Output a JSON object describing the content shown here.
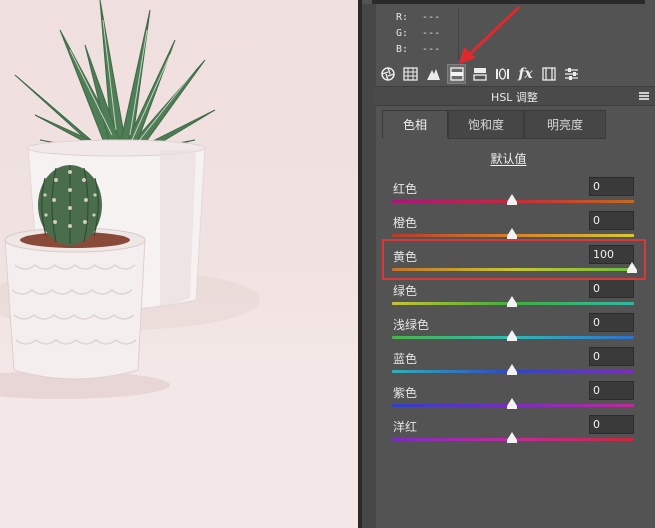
{
  "readout": {
    "r_label": "R:",
    "r_value": "---",
    "g_label": "G:",
    "g_value": "---",
    "b_label": "B:",
    "b_value": "---"
  },
  "toolbar": {
    "tools": [
      "basic-aperture-icon",
      "tone-curve-grid-icon",
      "detail-triangle-icon",
      "hsl-icon",
      "split-toning-icon",
      "lens-icon",
      "fx-icon",
      "camera-calibration-icon",
      "presets-sliders-icon"
    ],
    "active_index": 3,
    "fx_glyph": "fx"
  },
  "panel": {
    "title": "HSL 调整"
  },
  "tabs": [
    {
      "label": "色相",
      "active": true
    },
    {
      "label": "饱和度",
      "active": false
    },
    {
      "label": "明亮度",
      "active": false
    }
  ],
  "default_link": "默认值",
  "sliders": [
    {
      "label": "红色",
      "value": "0",
      "position": 0.5,
      "gradient": [
        "#b0127e",
        "#c8283c",
        "#c46a1e"
      ]
    },
    {
      "label": "橙色",
      "value": "0",
      "position": 0.5,
      "gradient": [
        "#b63a2a",
        "#d9822a",
        "#d8c830"
      ]
    },
    {
      "label": "黄色",
      "value": "100",
      "position": 1.0,
      "gradient": [
        "#c7722a",
        "#c8c632",
        "#6fbf3a"
      ]
    },
    {
      "label": "绿色",
      "value": "0",
      "position": 0.5,
      "gradient": [
        "#c7c234",
        "#3fae3e",
        "#2eb8a4"
      ]
    },
    {
      "label": "浅绿色",
      "value": "0",
      "position": 0.5,
      "gradient": [
        "#4ab54a",
        "#2fb8b4",
        "#2f6fcf"
      ]
    },
    {
      "label": "蓝色",
      "value": "0",
      "position": 0.5,
      "gradient": [
        "#2fb0b8",
        "#2f45c8",
        "#7e2bc2"
      ]
    },
    {
      "label": "紫色",
      "value": "0",
      "position": 0.5,
      "gradient": [
        "#2f3fc8",
        "#7a2bc4",
        "#c02a9a"
      ]
    },
    {
      "label": "洋红",
      "value": "0",
      "position": 0.5,
      "gradient": [
        "#7c2bc4",
        "#c22a9a",
        "#c8283c"
      ]
    }
  ],
  "colors": {
    "highlight": "#d8373b",
    "arrow": "#e0292e"
  }
}
